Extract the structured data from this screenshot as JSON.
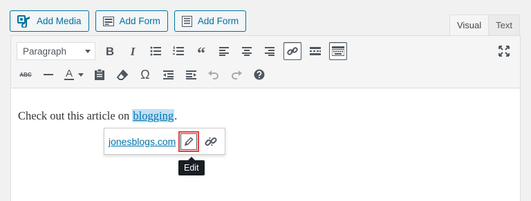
{
  "media_buttons": [
    {
      "label": "Add Media",
      "icon": "add-media-icon"
    },
    {
      "label": "Add Form",
      "icon": "form-icon"
    },
    {
      "label": "Add Form",
      "icon": "form-list-icon"
    }
  ],
  "tabs": {
    "visual": "Visual",
    "text": "Text"
  },
  "toolbar": {
    "format_select": "Paragraph",
    "bold": "B",
    "italic": "I",
    "blockquote": "“",
    "omega": "Ω",
    "strikethrough": "ABC",
    "text_color": "A"
  },
  "content": {
    "text_before": "Check out this article on ",
    "link_text": "blogging",
    "text_after": "."
  },
  "link_popup": {
    "url": "jonesblogs.com"
  },
  "tooltip": {
    "text": "Edit"
  },
  "colors": {
    "accent": "#0071a1",
    "highlight": "#e53d3d",
    "link": "#0073aa"
  }
}
